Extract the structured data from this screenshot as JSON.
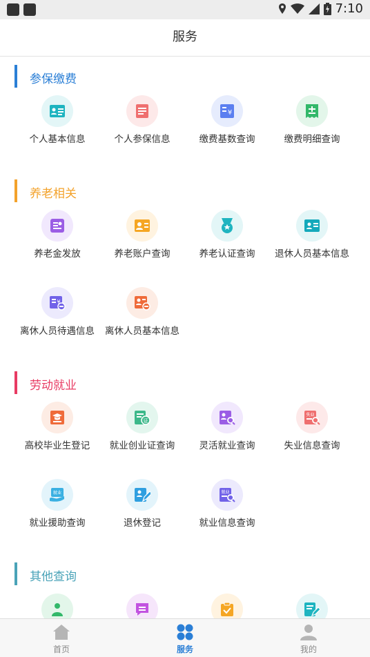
{
  "status_bar": {
    "time": "7:10"
  },
  "header": {
    "title": "服务"
  },
  "sections": [
    {
      "title": "参保缴费",
      "color": "#2b7fd6",
      "items": [
        {
          "label": "个人基本信息",
          "icon": "id-card-icon",
          "bg": "#e3f6f7",
          "fg": "#1eb4c0"
        },
        {
          "label": "个人参保信息",
          "icon": "document-icon",
          "bg": "#fde9e9",
          "fg": "#ef6f6f"
        },
        {
          "label": "缴费基数查询",
          "icon": "payment-base-icon",
          "bg": "#e6ecfd",
          "fg": "#5b7ff0"
        },
        {
          "label": "缴费明细查询",
          "icon": "receipt-icon",
          "bg": "#e3f6ea",
          "fg": "#33b86a"
        }
      ]
    },
    {
      "title": "养老相关",
      "color": "#f3a22b",
      "items": [
        {
          "label": "养老金发放",
          "icon": "pension-payout-icon",
          "bg": "#f1e8fd",
          "fg": "#9b5de5"
        },
        {
          "label": "养老账户查询",
          "icon": "pension-account-icon",
          "bg": "#fff3e0",
          "fg": "#f5a623"
        },
        {
          "label": "养老认证查询",
          "icon": "certification-medal-icon",
          "bg": "#e3f6f7",
          "fg": "#1eb4c0"
        },
        {
          "label": "退休人员基本信息",
          "icon": "retiree-card-icon",
          "bg": "#e3f6f7",
          "fg": "#14a9bb"
        },
        {
          "label": "离休人员待遇信息",
          "icon": "retiree-benefit-icon",
          "bg": "#eceafd",
          "fg": "#7162e8"
        },
        {
          "label": "离休人员基本信息",
          "icon": "retiree-info-icon",
          "bg": "#fdece4",
          "fg": "#ef6b3a"
        }
      ]
    },
    {
      "title": "劳动就业",
      "color": "#e83b63",
      "items": [
        {
          "label": "高校毕业生登记",
          "icon": "graduate-icon",
          "bg": "#fdece4",
          "fg": "#ef6b3a"
        },
        {
          "label": "就业创业证查询",
          "icon": "certificate-icon",
          "bg": "#e3f6ee",
          "fg": "#3cb88a"
        },
        {
          "label": "灵活就业查询",
          "icon": "flexible-job-search-icon",
          "bg": "#f1e8fd",
          "fg": "#9b5de5"
        },
        {
          "label": "失业信息查询",
          "icon": "unemployment-icon",
          "bg": "#fde9e9",
          "fg": "#ef6f6f"
        },
        {
          "label": "就业援助查询",
          "icon": "employment-aid-icon",
          "bg": "#e3f4fb",
          "fg": "#3ab0e2"
        },
        {
          "label": "退休登记",
          "icon": "retirement-register-icon",
          "bg": "#e3f4fb",
          "fg": "#2f9fe0"
        },
        {
          "label": "就业信息查询",
          "icon": "employment-info-icon",
          "bg": "#eceafd",
          "fg": "#7162e8"
        }
      ]
    },
    {
      "title": "其他查询",
      "color": "#4aa3b8",
      "items": [
        {
          "label": "",
          "icon": "person-icon",
          "bg": "#e3f6ea",
          "fg": "#33b86a"
        },
        {
          "label": "",
          "icon": "message-icon",
          "bg": "#f6e6fb",
          "fg": "#c253e0"
        },
        {
          "label": "",
          "icon": "checklist-icon",
          "bg": "#fff3e0",
          "fg": "#f5a623"
        },
        {
          "label": "",
          "icon": "edit-form-icon",
          "bg": "#e3f6f7",
          "fg": "#1eb4c0"
        }
      ]
    }
  ],
  "tabbar": [
    {
      "label": "首页",
      "icon": "home-icon",
      "active": false
    },
    {
      "label": "服务",
      "icon": "services-icon",
      "active": true
    },
    {
      "label": "我的",
      "icon": "profile-icon",
      "active": false
    }
  ]
}
